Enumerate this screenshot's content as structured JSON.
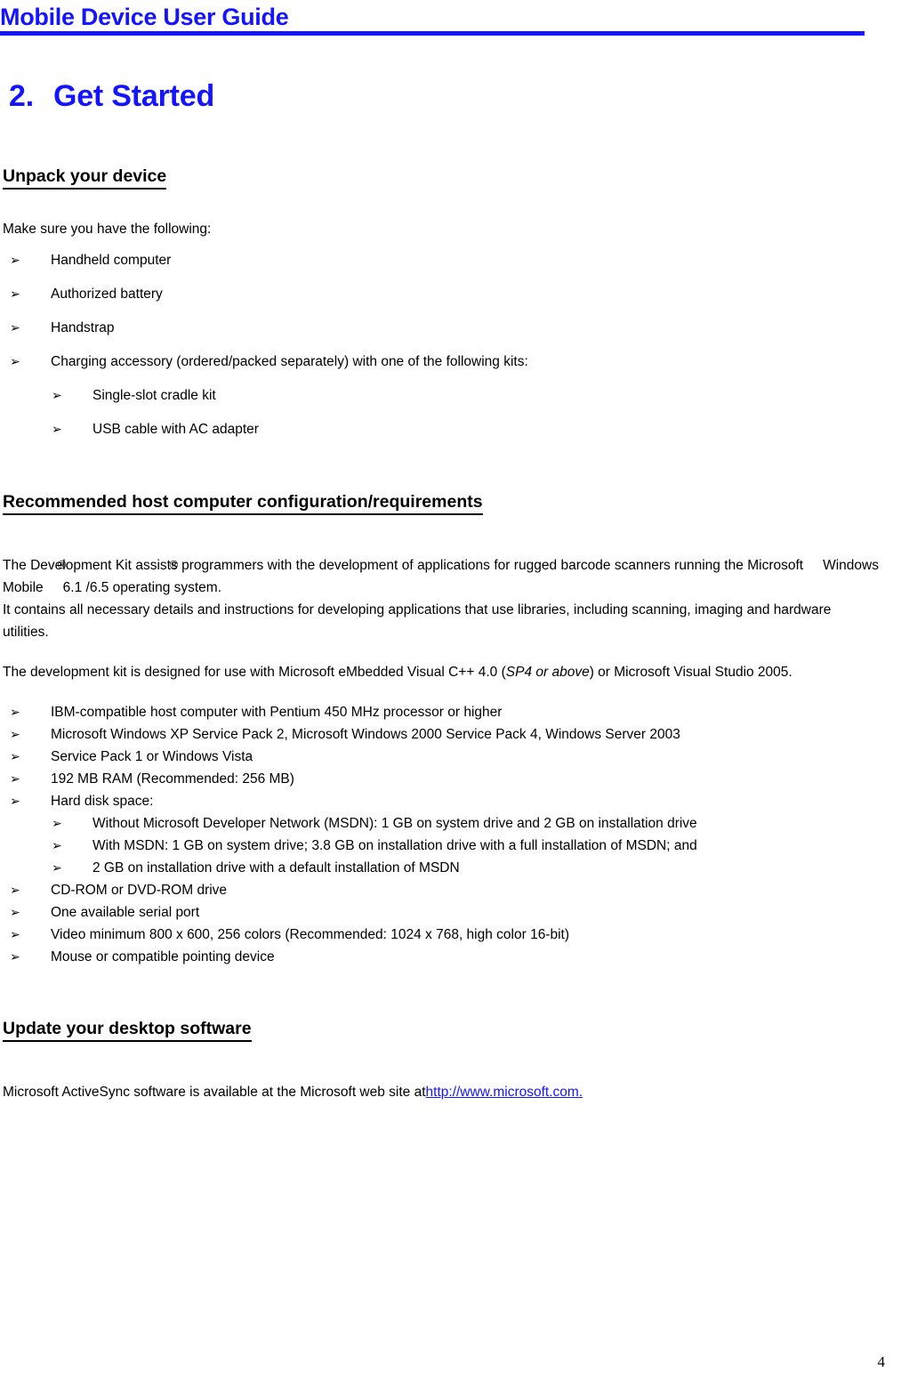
{
  "header": {
    "title": "Mobile Device User Guide",
    "rule_color": "#1414ff"
  },
  "chapter": {
    "number": "2.",
    "title": "Get Started"
  },
  "sections": [
    {
      "heading": "Unpack your device",
      "intro": "Make sure you have the following:",
      "items": [
        "Handheld computer",
        "Authorized battery",
        "Handstrap",
        "Charging accessory (ordered/packed separately) with one of the following kits:"
      ],
      "subitems": [
        "Single-slot cradle kit",
        "USB cable with AC adapter"
      ]
    },
    {
      "heading": "Recommended host computer configuration/requirements",
      "para1_a": "The Devel",
      "para1_reg1": "®",
      "para1_b": "opment Kit assists",
      "para1_reg2": "®",
      "para1_c": " programmers with the development of applications for rugged barcode scanners running the Microsoft",
      "para1_d": "Windows Mobile",
      "para1_e": "6.1 /6.5 operating system.",
      "para2": "It contains all necessary details and instructions for developing applications that use libraries, including scanning, imaging and hardware utilities.",
      "para3_a": "The development kit is designed for use with Microsoft eMbedded Visual C++ 4.0 (",
      "para3_italic": "SP4 or above",
      "para3_b": ") or Microsoft Visual Studio 2005.",
      "requirements": [
        "IBM-compatible host computer with Pentium 450 MHz processor or higher",
        "Microsoft Windows XP Service Pack 2, Microsoft Windows 2000 Service Pack 4, Windows Server 2003",
        "Service Pack 1 or Windows Vista",
        "192 MB RAM (Recommended: 256 MB)",
        "Hard disk space:"
      ],
      "disk_subitems": [
        "Without Microsoft Developer Network (MSDN): 1 GB on system drive and 2 GB on installation drive",
        "With MSDN: 1 GB on system drive; 3.8 GB on installation drive with a full installation of MSDN; and",
        "2 GB on installation drive with a default installation of MSDN"
      ],
      "requirements_cont": [
        "CD-ROM or DVD-ROM drive",
        "One available serial port",
        "Video minimum 800 x 600, 256 colors (Recommended: 1024 x 768, high color 16-bit)",
        "Mouse or compatible pointing device"
      ]
    },
    {
      "heading": "Update your desktop software",
      "para_a": "Microsoft ActiveSync software is available at the Microsoft web site at",
      "link_text": "http://www.microsoft.com.",
      "link_color": "#1414ff"
    }
  ],
  "footer": {
    "page_number": "4"
  },
  "icons": {
    "bullet_arrow": "➢"
  }
}
